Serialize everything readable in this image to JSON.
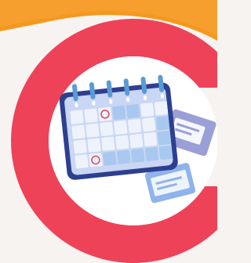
{
  "scene": {
    "description_colors": {
      "background": "#f7f3f0",
      "orange_swoosh": "#f5981c",
      "red_ring": "#ee4259",
      "inner_disc": "#ffffff",
      "calendar_frame": "#2d3f8f",
      "calendar_board": "#c9d6f4",
      "calendar_cell": "#eef2fb",
      "calendar_cell_highlight": "#a9c8ef",
      "ring_binder": "#5a9bd5",
      "marker_circle": "#e0455a",
      "card_blue": "#8fb3ec",
      "card_purple": "#9a9fd6"
    },
    "icons": [
      "calendar-icon",
      "note-card-icon",
      "note-card-icon"
    ]
  }
}
